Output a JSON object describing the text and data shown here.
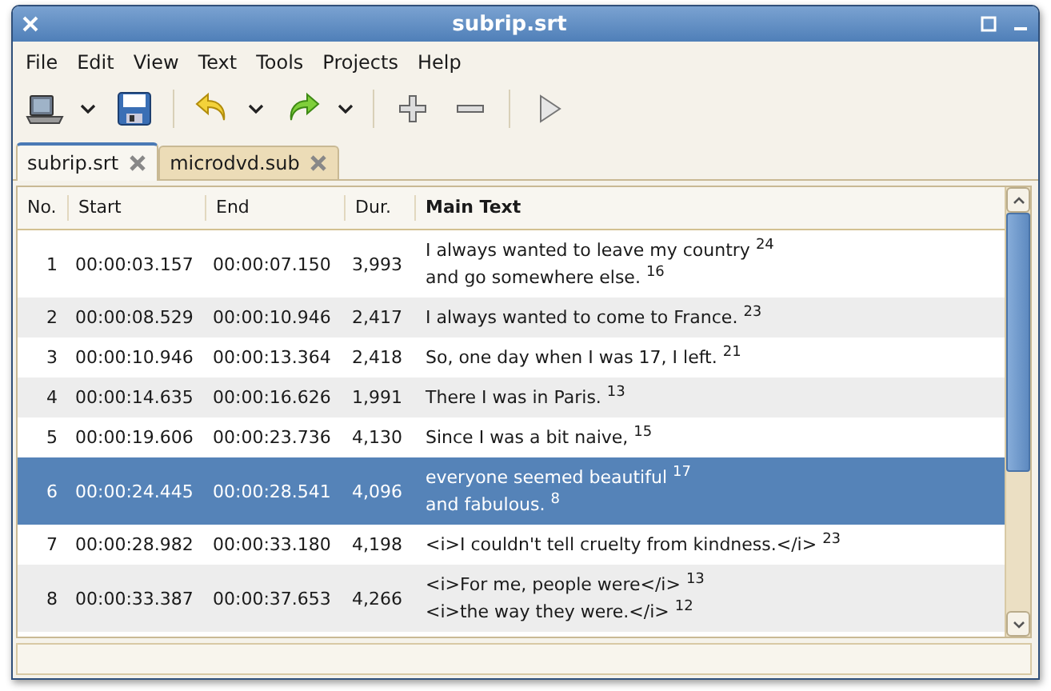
{
  "window": {
    "title": "subrip.srt"
  },
  "menu": [
    {
      "label": "File"
    },
    {
      "label": "Edit"
    },
    {
      "label": "View"
    },
    {
      "label": "Text"
    },
    {
      "label": "Tools"
    },
    {
      "label": "Projects"
    },
    {
      "label": "Help"
    }
  ],
  "tabs": [
    {
      "label": "subrip.srt",
      "selected": true
    },
    {
      "label": "microdvd.sub",
      "selected": false
    }
  ],
  "table": {
    "columns": [
      "No.",
      "Start",
      "End",
      "Dur.",
      "Main Text"
    ],
    "rows": [
      {
        "no": "1",
        "start": "00:00:03.157",
        "end": "00:00:07.150",
        "dur": "3,993",
        "text": [
          "I always wanted to leave my country $^{24}$",
          "and go somewhere else. $^{16}$"
        ],
        "selected": false
      },
      {
        "no": "2",
        "start": "00:00:08.529",
        "end": "00:00:10.946",
        "dur": "2,417",
        "text": [
          "I always wanted to come to France. $^{23}$"
        ],
        "selected": false
      },
      {
        "no": "3",
        "start": "00:00:10.946",
        "end": "00:00:13.364",
        "dur": "2,418",
        "text": [
          "So, one day when I was 17, I left. $^{21}$"
        ],
        "selected": false
      },
      {
        "no": "4",
        "start": "00:00:14.635",
        "end": "00:00:16.626",
        "dur": "1,991",
        "text": [
          "There I was in Paris. $^{13}$"
        ],
        "selected": false
      },
      {
        "no": "5",
        "start": "00:00:19.606",
        "end": "00:00:23.736",
        "dur": "4,130",
        "text": [
          "Since I was a bit naive, $^{15}$"
        ],
        "selected": false
      },
      {
        "no": "6",
        "start": "00:00:24.445",
        "end": "00:00:28.541",
        "dur": "4,096",
        "text": [
          "everyone seemed beautiful $^{17}$",
          "and fabulous. $^{8}$"
        ],
        "selected": true
      },
      {
        "no": "7",
        "start": "00:00:28.982",
        "end": "00:00:33.180",
        "dur": "4,198",
        "text": [
          "<i>I couldn't tell cruelty from kindness.</i> $^{23}$"
        ],
        "selected": false
      },
      {
        "no": "8",
        "start": "00:00:33.387",
        "end": "00:00:37.653",
        "dur": "4,266",
        "text": [
          "<i>For me, people were</i> $^{13}$",
          "<i>the way they were.</i> $^{12}$"
        ],
        "selected": false
      }
    ]
  }
}
